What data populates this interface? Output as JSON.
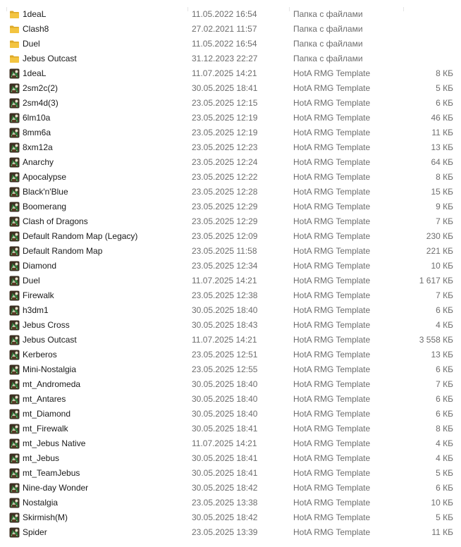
{
  "files": [
    {
      "icon": "folder-icon",
      "name": "1deaL",
      "date": "11.05.2022 16:54",
      "type": "Папка с файлами",
      "size": ""
    },
    {
      "icon": "folder-icon",
      "name": "Clash8",
      "date": "27.02.2021 11:57",
      "type": "Папка с файлами",
      "size": ""
    },
    {
      "icon": "folder-icon",
      "name": "Duel",
      "date": "11.05.2022 16:54",
      "type": "Папка с файлами",
      "size": ""
    },
    {
      "icon": "folder-icon",
      "name": "Jebus Outcast",
      "date": "31.12.2023 22:27",
      "type": "Папка с файлами",
      "size": ""
    },
    {
      "icon": "hota-template-icon",
      "name": "1deaL",
      "date": "11.07.2025 14:21",
      "type": "HotA RMG Template",
      "size": "8 КБ"
    },
    {
      "icon": "hota-template-icon",
      "name": "2sm2c(2)",
      "date": "30.05.2025 18:41",
      "type": "HotA RMG Template",
      "size": "5 КБ"
    },
    {
      "icon": "hota-template-icon",
      "name": "2sm4d(3)",
      "date": "23.05.2025 12:15",
      "type": "HotA RMG Template",
      "size": "6 КБ"
    },
    {
      "icon": "hota-template-icon",
      "name": "6lm10a",
      "date": "23.05.2025 12:19",
      "type": "HotA RMG Template",
      "size": "46 КБ"
    },
    {
      "icon": "hota-template-icon",
      "name": "8mm6a",
      "date": "23.05.2025 12:19",
      "type": "HotA RMG Template",
      "size": "11 КБ"
    },
    {
      "icon": "hota-template-icon",
      "name": "8xm12a",
      "date": "23.05.2025 12:23",
      "type": "HotA RMG Template",
      "size": "13 КБ"
    },
    {
      "icon": "hota-template-icon",
      "name": "Anarchy",
      "date": "23.05.2025 12:24",
      "type": "HotA RMG Template",
      "size": "64 КБ"
    },
    {
      "icon": "hota-template-icon",
      "name": "Apocalypse",
      "date": "23.05.2025 12:22",
      "type": "HotA RMG Template",
      "size": "8 КБ"
    },
    {
      "icon": "hota-template-icon",
      "name": "Black'n'Blue",
      "date": "23.05.2025 12:28",
      "type": "HotA RMG Template",
      "size": "15 КБ"
    },
    {
      "icon": "hota-template-icon",
      "name": "Boomerang",
      "date": "23.05.2025 12:29",
      "type": "HotA RMG Template",
      "size": "9 КБ"
    },
    {
      "icon": "hota-template-icon",
      "name": "Clash of Dragons",
      "date": "23.05.2025 12:29",
      "type": "HotA RMG Template",
      "size": "7 КБ"
    },
    {
      "icon": "hota-template-icon",
      "name": "Default Random Map (Legacy)",
      "date": "23.05.2025 12:09",
      "type": "HotA RMG Template",
      "size": "230 КБ"
    },
    {
      "icon": "hota-template-icon",
      "name": "Default Random Map",
      "date": "23.05.2025 11:58",
      "type": "HotA RMG Template",
      "size": "221 КБ"
    },
    {
      "icon": "hota-template-icon",
      "name": "Diamond",
      "date": "23.05.2025 12:34",
      "type": "HotA RMG Template",
      "size": "10 КБ"
    },
    {
      "icon": "hota-template-icon",
      "name": "Duel",
      "date": "11.07.2025 14:21",
      "type": "HotA RMG Template",
      "size": "1 617 КБ"
    },
    {
      "icon": "hota-template-icon",
      "name": "Firewalk",
      "date": "23.05.2025 12:38",
      "type": "HotA RMG Template",
      "size": "7 КБ"
    },
    {
      "icon": "hota-template-icon",
      "name": "h3dm1",
      "date": "30.05.2025 18:40",
      "type": "HotA RMG Template",
      "size": "6 КБ"
    },
    {
      "icon": "hota-template-icon",
      "name": "Jebus Cross",
      "date": "30.05.2025 18:43",
      "type": "HotA RMG Template",
      "size": "4 КБ"
    },
    {
      "icon": "hota-template-icon",
      "name": "Jebus Outcast",
      "date": "11.07.2025 14:21",
      "type": "HotA RMG Template",
      "size": "3 558 КБ"
    },
    {
      "icon": "hota-template-icon",
      "name": "Kerberos",
      "date": "23.05.2025 12:51",
      "type": "HotA RMG Template",
      "size": "13 КБ"
    },
    {
      "icon": "hota-template-icon",
      "name": "Mini-Nostalgia",
      "date": "23.05.2025 12:55",
      "type": "HotA RMG Template",
      "size": "6 КБ"
    },
    {
      "icon": "hota-template-icon",
      "name": "mt_Andromeda",
      "date": "30.05.2025 18:40",
      "type": "HotA RMG Template",
      "size": "7 КБ"
    },
    {
      "icon": "hota-template-icon",
      "name": "mt_Antares",
      "date": "30.05.2025 18:40",
      "type": "HotA RMG Template",
      "size": "6 КБ"
    },
    {
      "icon": "hota-template-icon",
      "name": "mt_Diamond",
      "date": "30.05.2025 18:40",
      "type": "HotA RMG Template",
      "size": "6 КБ"
    },
    {
      "icon": "hota-template-icon",
      "name": "mt_Firewalk",
      "date": "30.05.2025 18:41",
      "type": "HotA RMG Template",
      "size": "8 КБ"
    },
    {
      "icon": "hota-template-icon",
      "name": "mt_Jebus Native",
      "date": "11.07.2025 14:21",
      "type": "HotA RMG Template",
      "size": "4 КБ"
    },
    {
      "icon": "hota-template-icon",
      "name": "mt_Jebus",
      "date": "30.05.2025 18:41",
      "type": "HotA RMG Template",
      "size": "4 КБ"
    },
    {
      "icon": "hota-template-icon",
      "name": "mt_TeamJebus",
      "date": "30.05.2025 18:41",
      "type": "HotA RMG Template",
      "size": "5 КБ"
    },
    {
      "icon": "hota-template-icon",
      "name": "Nine-day Wonder",
      "date": "30.05.2025 18:42",
      "type": "HotA RMG Template",
      "size": "6 КБ"
    },
    {
      "icon": "hota-template-icon",
      "name": "Nostalgia",
      "date": "23.05.2025 13:38",
      "type": "HotA RMG Template",
      "size": "10 КБ"
    },
    {
      "icon": "hota-template-icon",
      "name": "Skirmish(M)",
      "date": "30.05.2025 18:42",
      "type": "HotA RMG Template",
      "size": "5 КБ"
    },
    {
      "icon": "hota-template-icon",
      "name": "Spider",
      "date": "23.05.2025 13:39",
      "type": "HotA RMG Template",
      "size": "11 КБ"
    }
  ],
  "colors": {
    "folder": "#f3c440",
    "folder_dark": "#dda928",
    "date_text": "#6d6d6d",
    "name_text": "#1a1a1a"
  }
}
